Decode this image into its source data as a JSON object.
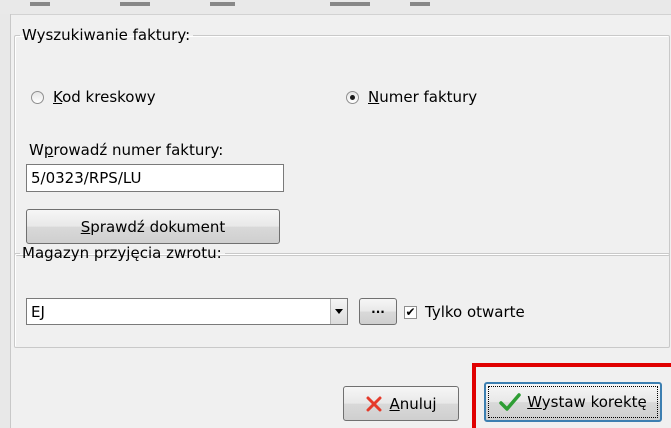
{
  "invoice_search": {
    "legend": "Wyszukiwanie faktury:",
    "options": [
      {
        "pre": "",
        "key": "K",
        "rest": "od kreskowy",
        "checked": false
      },
      {
        "pre": "",
        "key": "N",
        "rest": "umer faktury",
        "checked": true
      }
    ],
    "invoice_label": {
      "pre": "W",
      "key": "p",
      "rest": "rowadź numer faktury:"
    },
    "invoice_value": "5/0323/RPS/LU",
    "check_button": {
      "pre": "",
      "key": "S",
      "rest": "prawdź dokument"
    }
  },
  "warehouse": {
    "legend": "Magazyn przyjęcia zwrotu:",
    "selected": "EJ",
    "browse_label": "···",
    "only_open_label": "Tylko otwarte",
    "only_open_checked": "✔"
  },
  "actions": {
    "cancel": {
      "key": "A",
      "rest": "nuluj"
    },
    "submit": {
      "key": "W",
      "rest": "ystaw korektę"
    }
  },
  "colors": {
    "cancel_icon": "#e53b2b",
    "submit_icon": "#2e9d34",
    "highlight": "#e00000"
  }
}
